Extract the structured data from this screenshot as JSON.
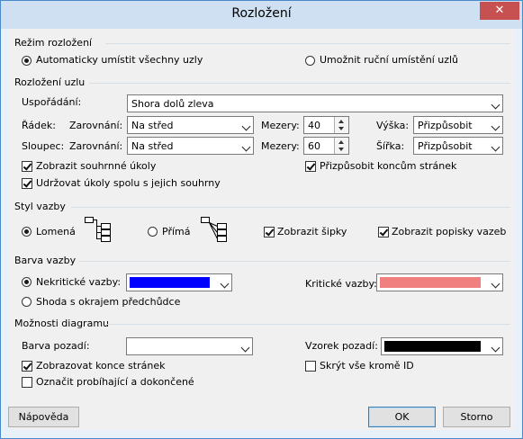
{
  "window": {
    "title": "Rozložení",
    "close_label": "✕"
  },
  "groups": {
    "placement": "Režim rozložení",
    "node_layout": "Rozložení uzlu",
    "link_style": "Styl vazby",
    "link_color": "Barva vazby",
    "diagram_options": "Možnosti diagramu"
  },
  "placement": {
    "auto_label": "Automaticky umístit všechny uzly",
    "manual_label": "Umožnit ruční umístění uzlů",
    "auto_selected": true
  },
  "node_layout": {
    "arrange_label": "Uspořádání:",
    "arrange_value": "Shora dolů zleva",
    "row_label": "Řádek:",
    "column_label": "Sloupec:",
    "align_label": "Zarovnání:",
    "row_align_value": "Na střed",
    "col_align_value": "Na střed",
    "spacing_label": "Mezery:",
    "row_spacing_value": "40",
    "col_spacing_value": "60",
    "height_label": "Výška:",
    "height_value": "Přizpůsobit",
    "width_label": "Šířka:",
    "width_value": "Přizpůsobit",
    "show_summary_label": "Zobrazit souhrnné úkoly",
    "keep_together_label": "Udržovat úkoly spolu s jejich souhrny",
    "adjust_page_breaks_label": "Přizpůsobit koncům stránek"
  },
  "link_style": {
    "rectilinear_label": "Lomená",
    "straight_label": "Přímá",
    "show_arrows_label": "Zobrazit šipky",
    "show_labels_label": "Zobrazit popisky vazeb"
  },
  "link_color": {
    "noncritical_label": "Nekritické vazby:",
    "noncritical_color": "#0000ff",
    "critical_label": "Kritické vazby:",
    "critical_color": "#f08080",
    "match_border_label": "Shoda s okrajem předchůdce"
  },
  "diagram_options": {
    "background_color_label": "Barva pozadí:",
    "background_color_value": "#ffffff",
    "background_pattern_label": "Vzorek pozadí:",
    "background_pattern_value": "#000000",
    "show_page_breaks_label": "Zobrazovat konce stránek",
    "hide_all_but_id_label": "Skrýt vše kromě ID",
    "mark_in_progress_label": "Označit probíhající a dokončené"
  },
  "buttons": {
    "help": "Nápověda",
    "ok": "OK",
    "cancel": "Storno"
  }
}
